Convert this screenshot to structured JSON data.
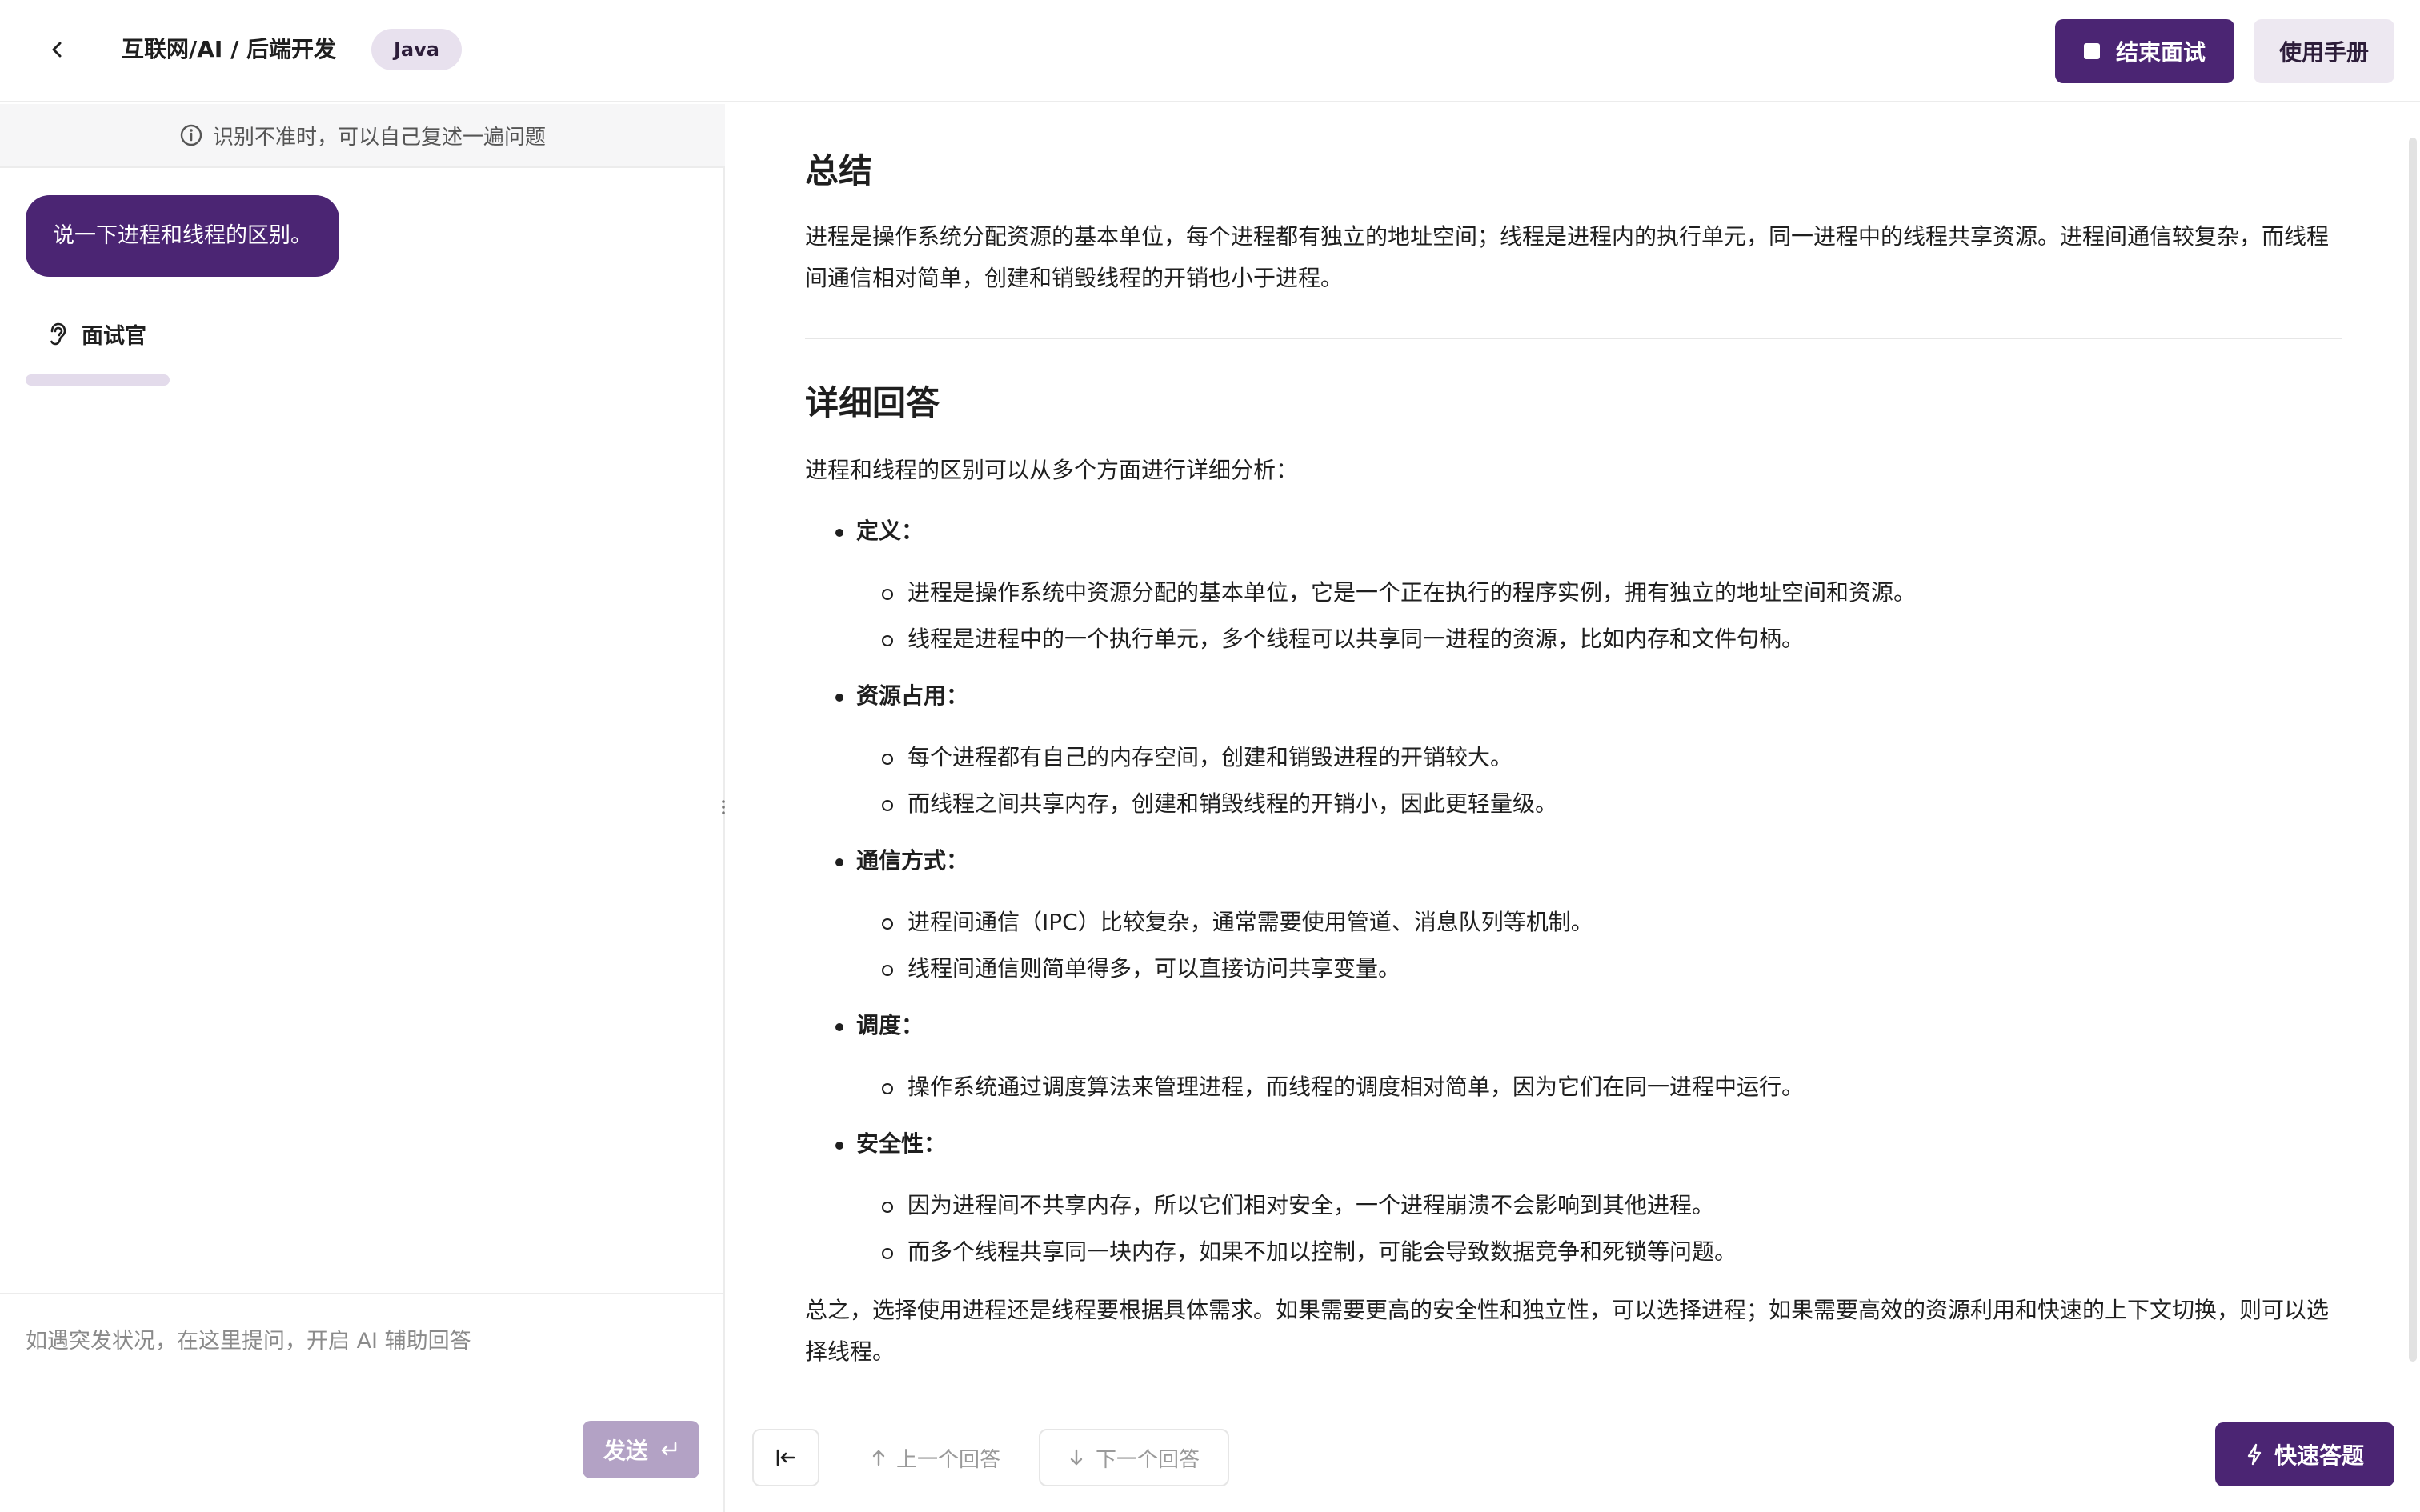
{
  "header": {
    "title": "互联网/AI / 后端开发",
    "badge": "Java",
    "end_button": "结束面试",
    "manual_button": "使用手册"
  },
  "left": {
    "hint": "识别不准时，可以自己复述一遍问题",
    "question": "说一下进程和线程的区别。",
    "interviewer_label": "面试官",
    "input_placeholder": "如遇突发状况，在这里提问，开启 AI 辅助回答",
    "send_label": "发送"
  },
  "answer": {
    "summary_title": "总结",
    "summary_text": "进程是操作系统分配资源的基本单位，每个进程都有独立的地址空间；线程是进程内的执行单元，同一进程中的线程共享资源。进程间通信较复杂，而线程间通信相对简单，创建和销毁线程的开销也小于进程。",
    "detail_title": "详细回答",
    "detail_intro": "进程和线程的区别可以从多个方面进行详细分析：",
    "sections": [
      {
        "term": "定义：",
        "items": [
          "进程是操作系统中资源分配的基本单位，它是一个正在执行的程序实例，拥有独立的地址空间和资源。",
          "线程是进程中的一个执行单元，多个线程可以共享同一进程的资源，比如内存和文件句柄。"
        ]
      },
      {
        "term": "资源占用：",
        "items": [
          "每个进程都有自己的内存空间，创建和销毁进程的开销较大。",
          "而线程之间共享内存，创建和销毁线程的开销小，因此更轻量级。"
        ]
      },
      {
        "term": "通信方式：",
        "items": [
          "进程间通信（IPC）比较复杂，通常需要使用管道、消息队列等机制。",
          "线程间通信则简单得多，可以直接访问共享变量。"
        ]
      },
      {
        "term": "调度：",
        "items": [
          "操作系统通过调度算法来管理进程，而线程的调度相对简单，因为它们在同一进程中运行。"
        ]
      },
      {
        "term": "安全性：",
        "items": [
          "因为进程间不共享内存，所以它们相对安全，一个进程崩溃不会影响到其他进程。",
          "而多个线程共享同一块内存，如果不加以控制，可能会导致数据竞争和死锁等问题。"
        ]
      }
    ],
    "conclusion": "总之，选择使用进程还是线程要根据具体需求。如果需要更高的安全性和独立性，可以选择进程；如果需要高效的资源利用和快速的上下文切换，则可以选择线程。"
  },
  "nav": {
    "prev_label": "上一个回答",
    "next_label": "下一个回答",
    "quick_label": "快速答题"
  },
  "colors": {
    "accent": "#4b2573",
    "badge_bg": "#e8e1ee",
    "send_disabled": "#b3a2c5"
  }
}
